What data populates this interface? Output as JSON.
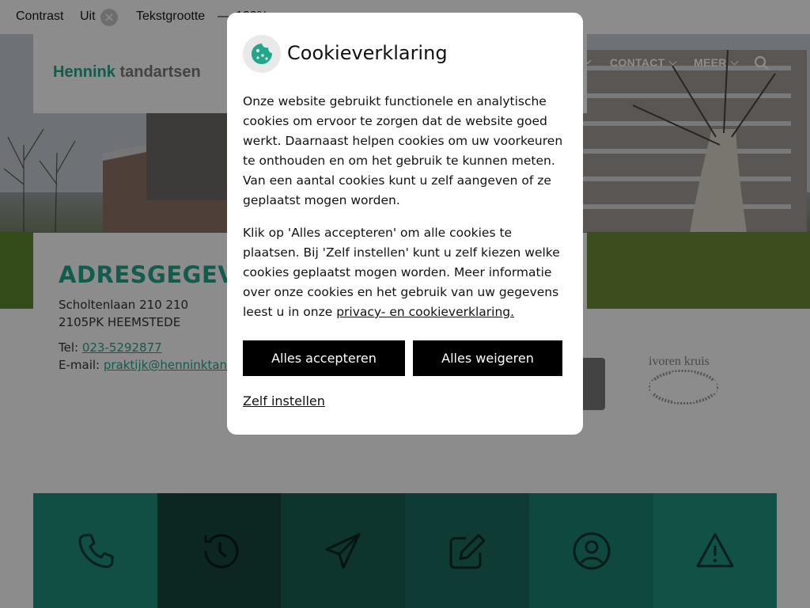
{
  "a11y": {
    "contrast_label": "Contrast",
    "contrast_value": "Uit",
    "textsize_label": "Tekstgrootte",
    "textsize_decrease": "—",
    "textsize_value": "100%"
  },
  "header": {
    "logo_part1": "Hennink",
    "logo_part2": "tandartsen",
    "nav": [
      {
        "label": "CONTACT"
      },
      {
        "label": "MEER"
      }
    ]
  },
  "address": {
    "title": "ADRESGEGEVENS",
    "street": "Scholtenlaan 210 210",
    "city": "2105PK HEEMSTEDE",
    "tel_label": "Tel: ",
    "tel_value": "023-5292877",
    "email_label": "E-mail: ",
    "email_value": "praktijk@henninktandartsen.nl"
  },
  "partners": {
    "ivoren_kruis": "ivoren kruis"
  },
  "tiles": [
    {
      "icon": "phone-icon",
      "color": "#1f8f7a"
    },
    {
      "icon": "history-icon",
      "color": "#16453f"
    },
    {
      "icon": "send-icon",
      "color": "#1a6b5f"
    },
    {
      "icon": "edit-icon",
      "color": "#1e7a6b"
    },
    {
      "icon": "user-icon",
      "color": "#1d8c79"
    },
    {
      "icon": "warning-icon",
      "color": "#1f9a83"
    }
  ],
  "cookie": {
    "title": "Cookieverklaring",
    "para1": "Onze website gebruikt functionele en analytische cookies om ervoor te zorgen dat de website goed werkt. Daarnaast helpen cookies om uw voorkeuren te onthouden en om het gebruik te kunnen meten. Van een aantal cookies kunt u zelf aangeven of ze geplaatst mogen worden.",
    "para2": "Klik op 'Alles accepteren' om alle cookies te plaatsen. Bij 'Zelf instellen' kunt u zelf kiezen welke cookies geplaatst mogen worden. Meer informatie over onze cookies en het gebruik van uw gegevens leest u in onze ",
    "privacy_link": "privacy- en cookieverklaring.",
    "accept_label": "Alles accepteren",
    "reject_label": "Alles weigeren",
    "customize_label": "Zelf instellen"
  },
  "colors": {
    "brand": "#23a68c",
    "overlay": "rgba(0,0,0,0.45)",
    "button": "#000000"
  }
}
